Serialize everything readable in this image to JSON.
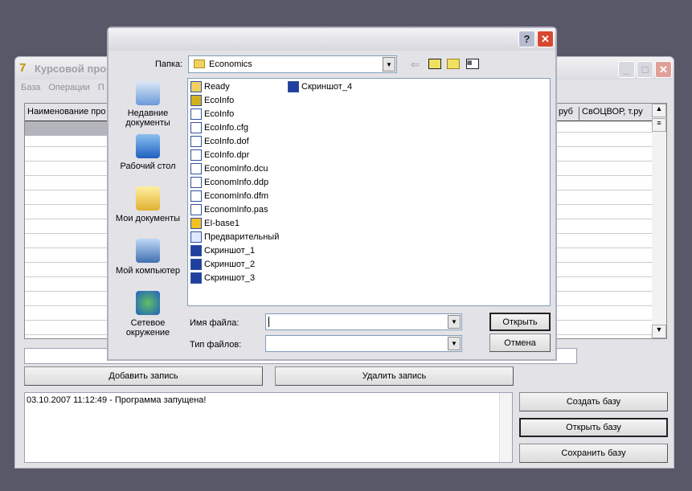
{
  "main": {
    "title": "Курсовой прое",
    "menu": [
      "База",
      "Операции",
      "П"
    ],
    "columns": [
      "Наименование про",
      "руб",
      "СвОЦВОР, т.ру"
    ],
    "add_button": "Добавить запись",
    "delete_button": "Удалить запись",
    "log": "03.10.2007 11:12:49 - Программа запущена!",
    "create_button": "Создать базу",
    "open_button": "Открыть базу",
    "save_button": "Сохранить базу"
  },
  "dialog": {
    "folder_label": "Папка:",
    "folder_value": "Economics",
    "places": [
      "Недавние документы",
      "Рабочий стол",
      "Мои документы",
      "Мой компьютер",
      "Сетевое окружение"
    ],
    "files": [
      {
        "name": "Ready",
        "icon": "folder-icon"
      },
      {
        "name": "EcoInfo",
        "icon": "delphi-project-icon"
      },
      {
        "name": "EcoInfo",
        "icon": "file-icon"
      },
      {
        "name": "EcoInfo.cfg",
        "icon": "file-icon"
      },
      {
        "name": "EcoInfo.dof",
        "icon": "file-icon"
      },
      {
        "name": "EcoInfo.dpr",
        "icon": "file-icon"
      },
      {
        "name": "EconomInfo.dcu",
        "icon": "file-icon"
      },
      {
        "name": "EconomInfo.ddp",
        "icon": "file-icon"
      },
      {
        "name": "EconomInfo.dfm",
        "icon": "file-icon"
      },
      {
        "name": "EconomInfo.pas",
        "icon": "file-icon"
      },
      {
        "name": "EI-base1",
        "icon": "database-icon"
      },
      {
        "name": "Предварительный",
        "icon": "doc-icon"
      },
      {
        "name": "Скриншот_1",
        "icon": "bmp-icon"
      },
      {
        "name": "Скриншот_2",
        "icon": "bmp-icon"
      },
      {
        "name": "Скриншот_3",
        "icon": "bmp-icon"
      },
      {
        "name": "Скриншот_4",
        "icon": "bmp-icon"
      }
    ],
    "filename_label": "Имя файла:",
    "filename_value": "",
    "filetype_label": "Тип файлов:",
    "filetype_value": "",
    "open_button": "Открыть",
    "cancel_button": "Отмена",
    "help": "?"
  }
}
